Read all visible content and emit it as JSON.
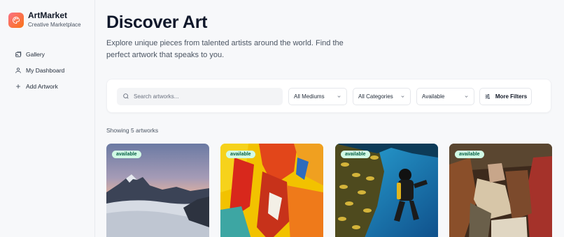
{
  "brand": {
    "name": "ArtMarket",
    "subtitle": "Creative Marketplace"
  },
  "nav": [
    {
      "label": "Gallery",
      "icon": "image-icon"
    },
    {
      "label": "My Dashboard",
      "icon": "user-icon"
    },
    {
      "label": "Add Artwork",
      "icon": "plus-icon"
    }
  ],
  "header": {
    "title": "Discover Art",
    "subtitle": "Explore unique pieces from talented artists around the world. Find the perfect artwork that speaks to you."
  },
  "filters": {
    "search_placeholder": "Search artworks...",
    "medium": "All Mediums",
    "category": "All Categories",
    "availability": "Available",
    "more_label": "More Filters"
  },
  "results": {
    "count_text": "Showing 5 artworks"
  },
  "artworks": [
    {
      "status": "available",
      "subject": "mountain landscape"
    },
    {
      "status": "available",
      "subject": "abstract painting"
    },
    {
      "status": "available",
      "subject": "scuba diver"
    },
    {
      "status": "available",
      "subject": "classical painting"
    }
  ],
  "colors": {
    "accent": "#f97316",
    "badge_bg": "#d1fae5",
    "badge_text": "#065f46"
  }
}
